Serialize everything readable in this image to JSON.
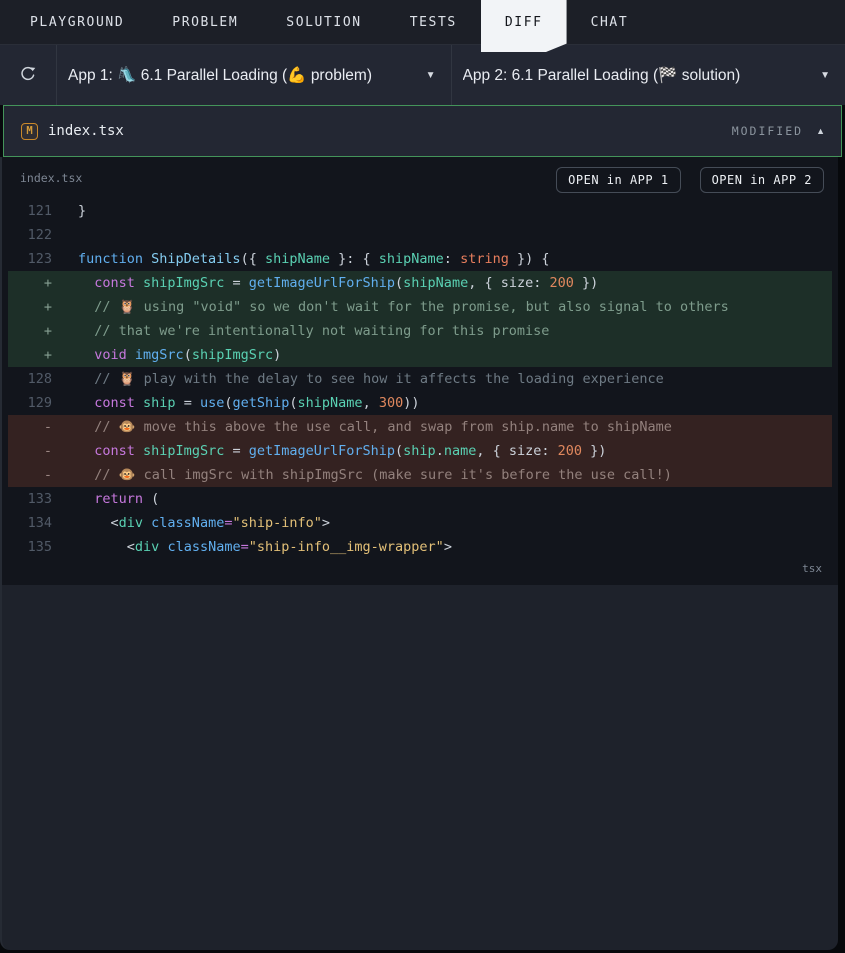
{
  "tabs": [
    {
      "label": "PLAYGROUND",
      "active": false
    },
    {
      "label": "PROBLEM",
      "active": false
    },
    {
      "label": "SOLUTION",
      "active": false
    },
    {
      "label": "TESTS",
      "active": false
    },
    {
      "label": "DIFF",
      "active": true
    },
    {
      "label": "CHAT",
      "active": false
    }
  ],
  "toolbar": {
    "refresh_icon": "refresh-circular-arrow",
    "app1_label": "App 1: 🛝 6.1 Parallel Loading (💪 problem)",
    "app2_label": "App 2: 6.1 Parallel Loading (🏁 solution)",
    "dropdown_caret": "▼"
  },
  "file_header": {
    "badge": "M",
    "filename": "index.tsx",
    "status": "MODIFIED",
    "collapse_icon": "▲"
  },
  "diff": {
    "filename_label": "index.tsx",
    "open_app1_label": "OPEN in APP 1",
    "open_app2_label": "OPEN in APP 2",
    "language_label": "tsx",
    "lines": [
      {
        "num": "121",
        "sign": "",
        "type": "ctx",
        "tokens": [
          {
            "t": "}",
            "c": "punct"
          }
        ]
      },
      {
        "num": "122",
        "sign": "",
        "type": "ctx",
        "tokens": []
      },
      {
        "num": "123",
        "sign": "",
        "type": "ctx",
        "tokens": [
          {
            "t": "function ",
            "c": "kwb"
          },
          {
            "t": "ShipDetails",
            "c": "cls"
          },
          {
            "t": "({ ",
            "c": "punct"
          },
          {
            "t": "shipName",
            "c": "var"
          },
          {
            "t": " }: { ",
            "c": "punct"
          },
          {
            "t": "shipName",
            "c": "var"
          },
          {
            "t": ": ",
            "c": "punct"
          },
          {
            "t": "string",
            "c": "type"
          },
          {
            "t": " }) {",
            "c": "punct"
          }
        ]
      },
      {
        "num": "",
        "sign": "+",
        "type": "add",
        "tokens": [
          {
            "t": "  ",
            "c": "punct"
          },
          {
            "t": "const",
            "c": "kw"
          },
          {
            "t": " ",
            "c": "punct"
          },
          {
            "t": "shipImgSrc",
            "c": "var"
          },
          {
            "t": " = ",
            "c": "punct"
          },
          {
            "t": "getImageUrlForShip",
            "c": "fn"
          },
          {
            "t": "(",
            "c": "punct"
          },
          {
            "t": "shipName",
            "c": "var"
          },
          {
            "t": ", { size: ",
            "c": "punct"
          },
          {
            "t": "200",
            "c": "num"
          },
          {
            "t": " })",
            "c": "punct"
          }
        ]
      },
      {
        "num": "",
        "sign": "+",
        "type": "add",
        "tokens": [
          {
            "t": "  // 🦉 using \"void\" so we don't wait for the promise, but also signal to others",
            "c": "cmt-add"
          }
        ]
      },
      {
        "num": "",
        "sign": "+",
        "type": "add",
        "tokens": [
          {
            "t": "  // that we're intentionally not waiting for this promise",
            "c": "cmt-add"
          }
        ]
      },
      {
        "num": "",
        "sign": "+",
        "type": "add",
        "tokens": [
          {
            "t": "  ",
            "c": "punct"
          },
          {
            "t": "void",
            "c": "kw"
          },
          {
            "t": " ",
            "c": "punct"
          },
          {
            "t": "imgSrc",
            "c": "fn"
          },
          {
            "t": "(",
            "c": "punct"
          },
          {
            "t": "shipImgSrc",
            "c": "var"
          },
          {
            "t": ")",
            "c": "punct"
          }
        ]
      },
      {
        "num": "128",
        "sign": "",
        "type": "ctx",
        "tokens": [
          {
            "t": "  // 🦉 play with the delay to see how it affects the loading experience",
            "c": "cmt"
          }
        ]
      },
      {
        "num": "129",
        "sign": "",
        "type": "ctx",
        "tokens": [
          {
            "t": "  ",
            "c": "punct"
          },
          {
            "t": "const",
            "c": "kw"
          },
          {
            "t": " ",
            "c": "punct"
          },
          {
            "t": "ship",
            "c": "var"
          },
          {
            "t": " = ",
            "c": "punct"
          },
          {
            "t": "use",
            "c": "fn"
          },
          {
            "t": "(",
            "c": "punct"
          },
          {
            "t": "getShip",
            "c": "fn"
          },
          {
            "t": "(",
            "c": "punct"
          },
          {
            "t": "shipName",
            "c": "var"
          },
          {
            "t": ", ",
            "c": "punct"
          },
          {
            "t": "300",
            "c": "num"
          },
          {
            "t": "))",
            "c": "punct"
          }
        ]
      },
      {
        "num": "",
        "sign": "-",
        "type": "del",
        "tokens": [
          {
            "t": "  // 🐵 move this above the use call, and swap from ship.name to shipName",
            "c": "cmt-del"
          }
        ]
      },
      {
        "num": "",
        "sign": "-",
        "type": "del",
        "tokens": [
          {
            "t": "  ",
            "c": "punct"
          },
          {
            "t": "const",
            "c": "kw"
          },
          {
            "t": " ",
            "c": "punct"
          },
          {
            "t": "shipImgSrc",
            "c": "var"
          },
          {
            "t": " = ",
            "c": "punct"
          },
          {
            "t": "getImageUrlForShip",
            "c": "fn"
          },
          {
            "t": "(",
            "c": "punct"
          },
          {
            "t": "ship",
            "c": "var"
          },
          {
            "t": ".",
            "c": "punct"
          },
          {
            "t": "name",
            "c": "var"
          },
          {
            "t": ", { size: ",
            "c": "punct"
          },
          {
            "t": "200",
            "c": "num"
          },
          {
            "t": " })",
            "c": "punct"
          }
        ]
      },
      {
        "num": "",
        "sign": "-",
        "type": "del",
        "tokens": [
          {
            "t": "  // 🐵 call imgSrc with shipImgSrc (make sure it's before the use call!)",
            "c": "cmt-del"
          }
        ]
      },
      {
        "num": "133",
        "sign": "",
        "type": "ctx",
        "tokens": [
          {
            "t": "  ",
            "c": "punct"
          },
          {
            "t": "return",
            "c": "kw"
          },
          {
            "t": " (",
            "c": "punct"
          }
        ]
      },
      {
        "num": "134",
        "sign": "",
        "type": "ctx",
        "tokens": [
          {
            "t": "    <",
            "c": "punct"
          },
          {
            "t": "div",
            "c": "var"
          },
          {
            "t": " ",
            "c": "punct"
          },
          {
            "t": "className",
            "c": "fn"
          },
          {
            "t": "=",
            "c": "op"
          },
          {
            "t": "\"ship-info\"",
            "c": "str"
          },
          {
            "t": ">",
            "c": "punct"
          }
        ]
      },
      {
        "num": "135",
        "sign": "",
        "type": "ctx",
        "tokens": [
          {
            "t": "      <",
            "c": "punct"
          },
          {
            "t": "div",
            "c": "var"
          },
          {
            "t": " ",
            "c": "punct"
          },
          {
            "t": "className",
            "c": "fn"
          },
          {
            "t": "=",
            "c": "op"
          },
          {
            "t": "\"ship-info__img-wrapper\"",
            "c": "str"
          },
          {
            "t": ">",
            "c": "punct"
          }
        ]
      }
    ]
  },
  "colors": {
    "accent_green_border": "#44945a",
    "added_line_bg": "#1d2f28",
    "deleted_line_bg": "#342221",
    "modified_badge_orange": "#c9882a",
    "active_tab_bg": "#f2f4f7",
    "panel_bg": "#232733",
    "code_bg": "#12151c"
  }
}
